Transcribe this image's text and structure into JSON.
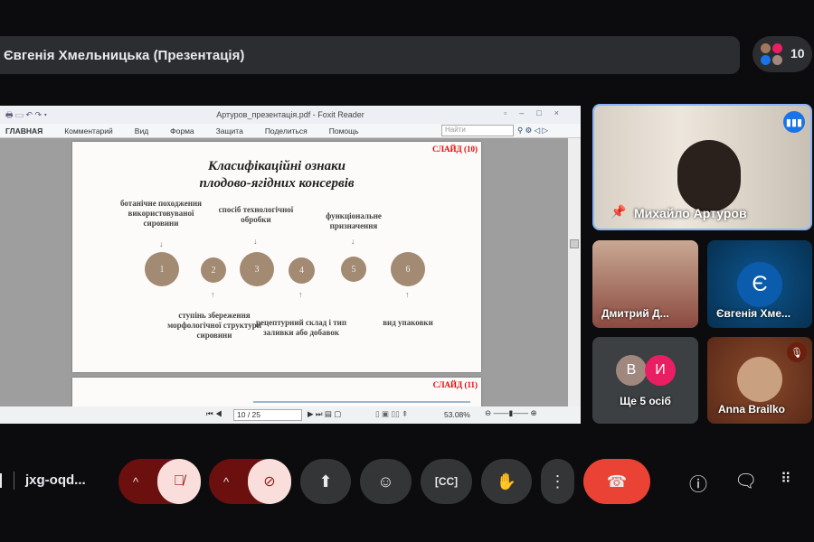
{
  "meeting_title": "Євгенія Хмельницька (Презентація)",
  "participant_count": "10",
  "foxit": {
    "window_title": "Артуров_презентація.pdf - Foxit Reader",
    "menu": [
      "ГЛАВНАЯ",
      "Комментарий",
      "Вид",
      "Форма",
      "Защита",
      "Поделиться",
      "Помощь"
    ],
    "search_placeholder": "Найти",
    "page_value": "10 / 25",
    "zoom": "53.08%"
  },
  "slide": {
    "number": "СЛАЙД (10)",
    "title_line1": "Класифікаційні ознаки",
    "title_line2": "плодово-ягідних консервів",
    "circles": [
      "1",
      "2",
      "3",
      "4",
      "5",
      "6"
    ],
    "labels_top": [
      "ботанічне походження використовуваної сировини",
      "спосіб технологічної обробки",
      "функціональне призначення"
    ],
    "labels_bottom": [
      "ступінь збереження морфологічної структури сировини",
      "рецептурний склад і тип заливки або добавок",
      "вид упаковки"
    ],
    "accent_color": "#a38a72"
  },
  "slide_next": {
    "number": "СЛАЙД (11)"
  },
  "tiles": [
    {
      "name": "Михайло Артуров",
      "speaking": true
    },
    {
      "name": "Дмитрий Д..."
    },
    {
      "name": "Євгенія Хме...",
      "initial": "Є"
    },
    {
      "name": "Ще 5 осіб",
      "initials": [
        "В",
        "И"
      ]
    },
    {
      "name": "Anna Brailko",
      "muted": true
    }
  ],
  "bottom": {
    "meeting_code": "jxg-oqd...",
    "hangup_color": "#ea4335"
  }
}
